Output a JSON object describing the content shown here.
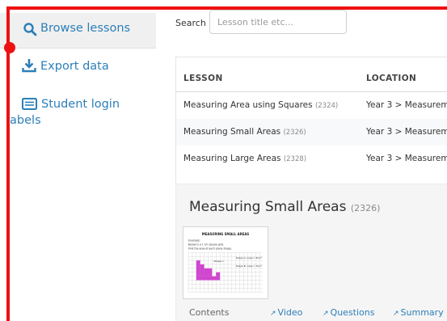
{
  "sidebar": {
    "items": [
      {
        "label": "Browse lessons",
        "icon": "search-icon"
      },
      {
        "label": "Export data",
        "icon": "download-icon"
      },
      {
        "label_line1": "Student login",
        "label_line2": "labels",
        "icon": "id-card-icon"
      }
    ]
  },
  "search": {
    "label": "Search",
    "placeholder": "Lesson title etc..."
  },
  "table": {
    "headers": [
      "LESSON",
      "LOCATION"
    ],
    "rows": [
      {
        "title": "Measuring Area using Squares",
        "id": "(2324)",
        "location": "Year 3 > Measurem"
      },
      {
        "title": "Measuring Small Areas",
        "id": "(2326)",
        "location": "Year 3 > Measurem"
      },
      {
        "title": "Measuring Large Areas",
        "id": "(2328)",
        "location": "Year 3 > Measurem"
      }
    ]
  },
  "detail": {
    "title": "Measuring Small Areas",
    "id": "(2326)",
    "thumbnail": {
      "heading": "MEASURING SMALL AREAS",
      "line1": "Example:",
      "line2": "Below is a 1 cm square grid.",
      "line3": "Find the area of each plane shape.",
      "shape_a": "Shape A: Area = 8cm²",
      "shape_b": "Shape B: Area = 6cm²",
      "shape_c": "Shape C"
    },
    "contents_label": "Contents",
    "links": [
      "Video",
      "Questions",
      "Summary"
    ]
  },
  "colors": {
    "accent": "#2c7fb8",
    "highlight_frame": "#ee1111",
    "active_bg": "#f0f0f0"
  }
}
